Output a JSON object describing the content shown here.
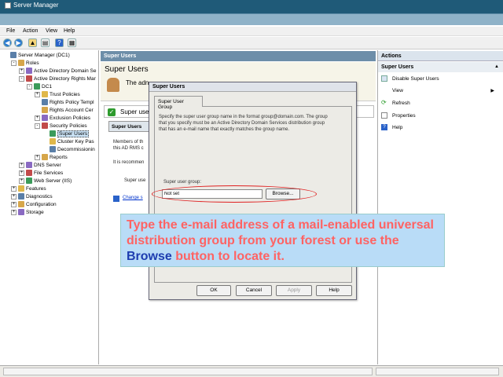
{
  "window": {
    "title": "Server Manager"
  },
  "menu": [
    "File",
    "Action",
    "View",
    "Help"
  ],
  "toolbar_icons": [
    "back-icon",
    "forward-icon",
    "up-folder-icon",
    "show-hide-tree-icon",
    "help-icon",
    "properties-icon"
  ],
  "tree": [
    {
      "label": "Server Manager (DC1)",
      "indent": 0,
      "expander": ""
    },
    {
      "label": "Roles",
      "indent": 1,
      "expander": "-"
    },
    {
      "label": "Active Directory Domain Se",
      "indent": 2,
      "expander": "+"
    },
    {
      "label": "Active Directory Rights Mar",
      "indent": 2,
      "expander": "-"
    },
    {
      "label": "DC1",
      "indent": 3,
      "expander": "-"
    },
    {
      "label": "Trust Policies",
      "indent": 4,
      "expander": "+"
    },
    {
      "label": "Rights Policy Templ",
      "indent": 4,
      "expander": ""
    },
    {
      "label": "Rights Account Cer",
      "indent": 4,
      "expander": ""
    },
    {
      "label": "Exclusion Policies",
      "indent": 4,
      "expander": "+"
    },
    {
      "label": "Security Policies",
      "indent": 4,
      "expander": "-"
    },
    {
      "label": "Super Users",
      "indent": 5,
      "expander": "",
      "selected": true
    },
    {
      "label": "Cluster Key Pas",
      "indent": 5,
      "expander": ""
    },
    {
      "label": "Decommissionin",
      "indent": 5,
      "expander": ""
    },
    {
      "label": "Reports",
      "indent": 4,
      "expander": "+"
    },
    {
      "label": "DNS Server",
      "indent": 2,
      "expander": "+"
    },
    {
      "label": "File Services",
      "indent": 2,
      "expander": "+"
    },
    {
      "label": "Web Server (IIS)",
      "indent": 2,
      "expander": "+"
    },
    {
      "label": "Features",
      "indent": 1,
      "expander": "+"
    },
    {
      "label": "Diagnostics",
      "indent": 1,
      "expander": "+"
    },
    {
      "label": "Configuration",
      "indent": 1,
      "expander": "+"
    },
    {
      "label": "Storage",
      "indent": 1,
      "expander": "+"
    }
  ],
  "center": {
    "header": "Super Users",
    "banner_title": "Super Users",
    "banner_text": "The adn",
    "status_row": "Super use",
    "sub_header": "Super Users",
    "members_text": "Members of th",
    "rms_text": "this AD RMS c",
    "recommend_text": "It is recommen",
    "super_user_text": "Super use",
    "change_link": "Change s"
  },
  "actions": {
    "header": "Actions",
    "sub_header": "Super Users",
    "items": [
      {
        "label": "Disable Super Users",
        "icon": "disable-icon",
        "arrow": false
      },
      {
        "label": "View",
        "icon": "",
        "arrow": true
      },
      {
        "label": "Refresh",
        "icon": "refresh-icon",
        "arrow": false
      },
      {
        "label": "Properties",
        "icon": "properties-icon",
        "arrow": false
      },
      {
        "label": "Help",
        "icon": "help-icon",
        "arrow": false
      }
    ]
  },
  "dialog": {
    "title": "Super Users",
    "tab": "Super User Group",
    "description": "Specify the super user group name in the format group@domain.com. The group that you specify must be an Active Directory Domain Services distribution group that has an e-mail name that exactly matches the group name.",
    "field_label": "Super user group:",
    "field_value": "Not set",
    "browse_button": "Browse...",
    "ok_button": "OK",
    "cancel_button": "Cancel",
    "apply_button": "Apply",
    "help_button": "Help"
  },
  "callout": {
    "text_before": "Type the e-mail address of a mail-enabled universal distribution group from your forest or use the ",
    "keyword": "Browse",
    "text_after": " button to locate it."
  },
  "colors": {
    "titlebar": "#1f5a78",
    "pane_header": "#6d8ea9",
    "callout_bg": "#b9dcf7",
    "callout_text": "#ff6363",
    "callout_keyword": "#1e3db0",
    "highlight_oval": "#e02020"
  }
}
